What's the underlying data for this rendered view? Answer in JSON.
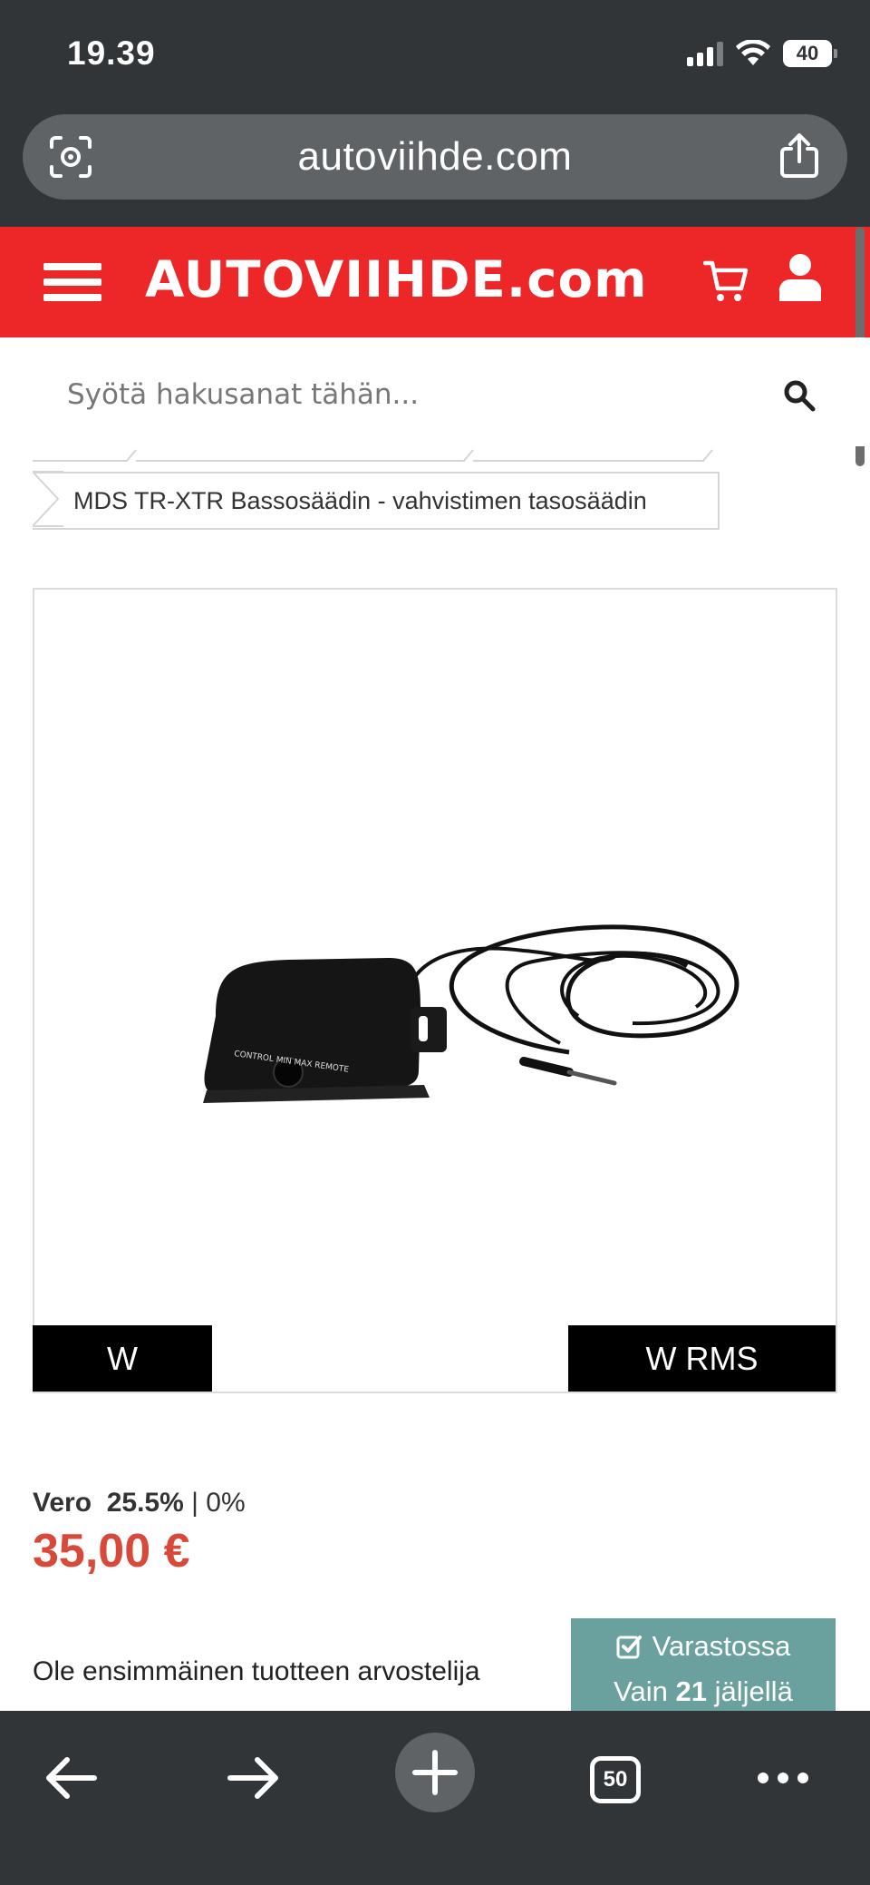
{
  "status_bar": {
    "time": "19.39",
    "battery": "40"
  },
  "browser": {
    "url": "autoviihde.com",
    "tab_count": "50"
  },
  "site": {
    "logo_text": "AUTOVIIHDE.com",
    "brand_color": "#ed2628"
  },
  "search": {
    "placeholder": "Syötä hakusanat tähän..."
  },
  "breadcrumb": {
    "current": "MDS TR-XTR Bassosäädin - vahvistimen tasosäädin"
  },
  "product": {
    "badge_left": "W",
    "badge_right": "W RMS",
    "tax_label": "Vero",
    "tax_value": "25.5%",
    "tax_alt": "| 0%",
    "price": "35,00 €",
    "review_link": "Ole ensimmäinen tuotteen arvostelija",
    "stock_status": "Varastossa",
    "stock_prefix": "Vain",
    "stock_count": "21",
    "stock_suffix": "jäljellä"
  },
  "icons": [
    "camera-search-icon",
    "share-icon",
    "hamburger-icon",
    "cart-icon",
    "user-icon",
    "search-icon",
    "check-icon",
    "back-icon",
    "forward-icon",
    "plus-icon",
    "tabs-icon",
    "more-icon"
  ]
}
